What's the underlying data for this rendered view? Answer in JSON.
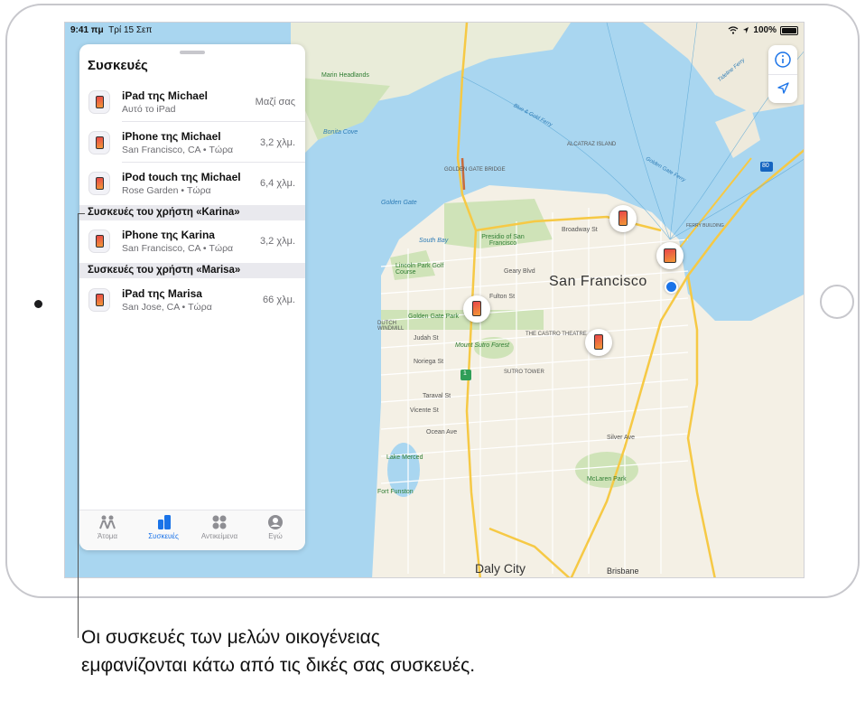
{
  "status_bar": {
    "time": "9:41 πμ",
    "date": "Τρί 15 Σεπ",
    "battery": "100%"
  },
  "panel": {
    "title": "Συσκευές",
    "my_devices": [
      {
        "name": "iPad της Michael",
        "subtitle": "Αυτό το iPad",
        "distance": "Μαζί σας",
        "icon": "ipad-icon"
      },
      {
        "name": "iPhone της Michael",
        "subtitle": "San Francisco, CA • Τώρα",
        "distance": "3,2 χλμ.",
        "icon": "iphone-icon"
      },
      {
        "name": "iPod touch της Michael",
        "subtitle": "Rose Garden • Τώρα",
        "distance": "6,4 χλμ.",
        "icon": "ipod-icon"
      }
    ],
    "sections": [
      {
        "header": "Συσκευές του χρήστη «Karina»",
        "devices": [
          {
            "name": "iPhone της Karina",
            "subtitle": "San Francisco, CA • Τώρα",
            "distance": "3,2 χλμ.",
            "icon": "iphone-icon"
          }
        ]
      },
      {
        "header": "Συσκευές του χρήστη «Marisa»",
        "devices": [
          {
            "name": "iPad της Marisa",
            "subtitle": "San Jose, CA • Τώρα",
            "distance": "66 χλμ.",
            "icon": "ipad-icon"
          }
        ]
      }
    ],
    "tabs": [
      {
        "label": "Άτομα",
        "icon": "people-icon",
        "active": false
      },
      {
        "label": "Συσκευές",
        "icon": "devices-icon",
        "active": true
      },
      {
        "label": "Αντικείμενα",
        "icon": "items-icon",
        "active": false
      },
      {
        "label": "Εγώ",
        "icon": "me-icon",
        "active": false
      }
    ]
  },
  "map": {
    "city_label": "San Francisco",
    "labels": {
      "marin_headlands": "Marin Headlands",
      "bonita_cove": "Bonita Cove",
      "golden_gate": "Golden Gate",
      "golden_gate_bridge": "GOLDEN GATE BRIDGE",
      "alcatraz": "ALCATRAZ ISLAND",
      "presidio": "Presidio of San Francisco",
      "south_bay": "South Bay",
      "lincoln_park": "Lincoln Park Golf Course",
      "gg_park": "Golden Gate Park",
      "mount_sutro": "Mount Sutro Forest",
      "castro": "THE CASTRO THEATRE",
      "sutro_tower": "SUTRO TOWER",
      "dutch_windmill": "DUTCH WINDMILL",
      "ocean_ave": "Ocean Ave",
      "lake_merced": "Lake Merced",
      "fort_funston": "Fort Funston",
      "mclaren": "McLaren Park",
      "daly_city": "Daly City",
      "brisbane": "Brisbane",
      "ferry_building": "FERRY BUILDING",
      "blue_gold_ferry": "Blue & Gold Ferry",
      "golden_gate_ferry": "Golden Gate Ferry",
      "tideline_ferry": "Tideline Ferry",
      "geary": "Geary Blvd",
      "fulton": "Fulton St",
      "judah": "Judah St",
      "noriega": "Noriega St",
      "taraval": "Taraval St",
      "vicente": "Vicente St",
      "broadway": "Broadway St",
      "silver": "Silver Ave",
      "hwy1": "1",
      "hwy80": "80"
    }
  },
  "callout": "Οι συσκευές των μελών οικογένειας εμφανίζονται κάτω από τις δικές σας συσκευές."
}
